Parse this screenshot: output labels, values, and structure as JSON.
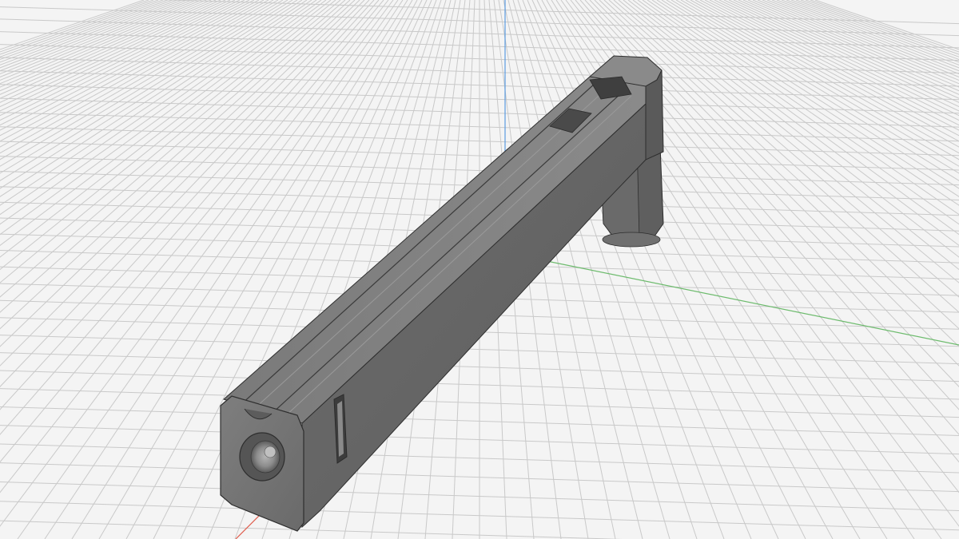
{
  "viewport": {
    "background": "#f4f4f4",
    "grid_color": "#c9c9c9",
    "grid_major_color": "#bdbdbd",
    "model_color": "#6e6e6e"
  },
  "axes": {
    "x_color": "#e05a4a",
    "y_color": "#6dbb6d",
    "z_color": "#5a9be0"
  }
}
